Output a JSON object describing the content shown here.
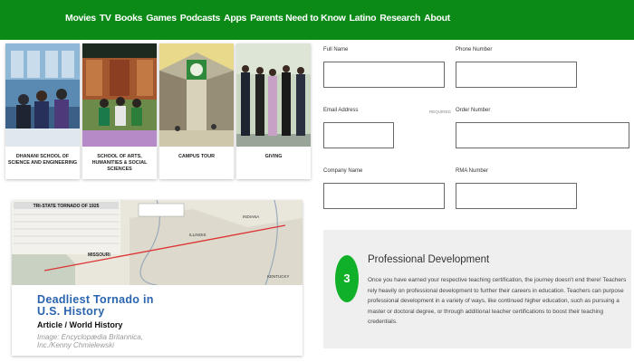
{
  "nav": {
    "items": [
      "Movies",
      "TV",
      "Books",
      "Games",
      "Podcasts",
      "Apps",
      "Parents Need to Know",
      "Latino",
      "Research",
      "About"
    ]
  },
  "cards": [
    {
      "caption": "DHANANI SCHOOL OF SCIENCE AND ENGINEERING"
    },
    {
      "caption": "SCHOOL OF ARTS, HUMANITIES & SOCIAL SCIENCES"
    },
    {
      "caption": "CAMPUS TOUR"
    },
    {
      "caption": "GIVING"
    }
  ],
  "tornado": {
    "title_line1": "Deadliest Tornado in",
    "title_line2": "U.S. History",
    "subtitle": "Article / World History",
    "credit_line1": "Image: Encyclopædia Britannica,",
    "credit_line2": "Inc./Kenny Chmielewski",
    "map_header": "TRI-STATE TORNADO OF 1925",
    "map_state_1": "MISSOURI",
    "map_state_2": "ILLINOIS",
    "map_state_3": "INDIANA",
    "map_state_4": "KENTUCKY"
  },
  "form": {
    "full_name_label": "Full Name",
    "phone_label": "Phone Number",
    "email_label": "Email Address",
    "email_required": "REQUIRED",
    "order_label": "Order Number",
    "company_label": "Company Name",
    "rma_label": "RMA Number"
  },
  "feature": {
    "number": "3",
    "heading": "Professional Development",
    "body": "Once you have earned your respective teaching certification, the journey doesn't end there! Teachers rely heavily on professional development to further their careers in education. Teachers can purpose professional development in a variety of ways, like continued higher education, such as pursuing a master or doctoral degree, or through additional teacher certifications to boost their teaching credentials."
  },
  "colors": {
    "nav_bg": "#0b8a17",
    "badge_bg": "#10b028",
    "title_blue": "#2a64ae"
  }
}
